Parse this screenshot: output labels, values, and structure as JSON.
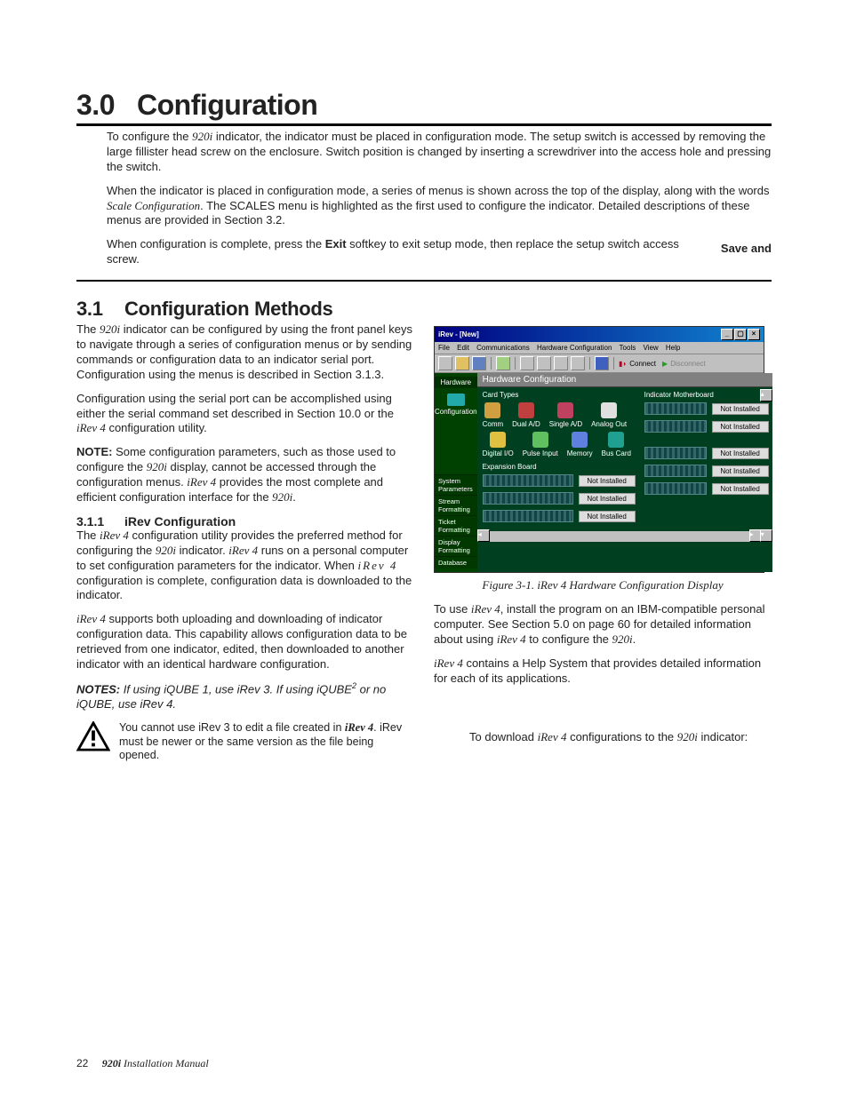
{
  "chapter": {
    "num": "3.0",
    "title": "Configuration"
  },
  "intro": {
    "p1_a": "To configure the ",
    "prod": "920i",
    "p1_b": " indicator, the indicator must be placed in configuration mode. The setup switch is accessed by removing the large fillister head screw on the enclosure. Switch position is changed by inserting a screwdriver into the access hole and pressing the switch.",
    "p2_a": "When the indicator is placed in configuration mode, a series of menus is shown across the top of the display, along with the words ",
    "p2_i": "Scale Configuration",
    "p2_b": ". The SCALES menu is highlighted as the first used to configure the indicator. Detailed descriptions of these menus are provided in Section 3.2.",
    "p3_a": "When configuration is complete, press the ",
    "p3_k": "Exit",
    "p3_b": " softkey to exit setup mode, then replace the setup switch access screw.",
    "aside_k": "Save and"
  },
  "section": {
    "num": "3.1",
    "title": "Configuration Methods"
  },
  "left": {
    "lead_a": "The ",
    "lead_b": " indicator can be configured by using the front panel keys to navigate through a series of configuration menus or by sending commands or configuration data to an indicator serial port. Configuration using the menus is described in Section 3.1.3.",
    "p2": "Configuration using the serial port can be accomplished using either the serial command set described in Section 10.0 or the ",
    "p2_i": "iRev 4",
    "p2_end": " configuration utility.",
    "note_lbl": "NOTE:",
    "note_a": " Some configuration parameters, such as those used to configure the ",
    "note_b": " display, cannot be accessed through the configuration menus. ",
    "note_c": " provides the most complete and efficient configuration interface for the ",
    "note_d": ".",
    "subsec": {
      "num": "3.1.1",
      "title": "iRev Configuration"
    },
    "s1_a": "The ",
    "s1_b": " configuration utility provides the preferred method for configuring the ",
    "s1_c": " indicator. ",
    "s1_d": " runs on a personal computer to set configuration parameters for the indicator. When ",
    "s1_e": " configuration is complete, configuration data is downloaded to the indicator.",
    "s2_a": "iRev 4",
    "s2_b": " supports both uploading and downloading of indicator configuration data. This capability allows configuration data to be retrieved from one indicator, edited, then downloaded to another indicator with an identical hardware configuration.",
    "notes_lbl": "NOTES:",
    "notes_txt": " If using iQUBE 1, use iRev 3. If using iQUBE",
    "notes_sup": "2",
    "notes_txt2": " or no iQUBE, use iRev 4.",
    "warn_a": "You cannot use iRev 3 to edit a file created in ",
    "warn_b": ". iRev must be newer or the same version as the file being opened."
  },
  "right": {
    "figcap_a": "Figure 3-1. ",
    "figcap_b": " Hardware Configuration Display",
    "p1_a": "To use ",
    "p1_b": ", install the program on an IBM-compatible personal computer. See Section 5.0 on page 60 for detailed information about using ",
    "p1_c": " to configure the ",
    "p1_d": ".",
    "p2_a": "iRev 4",
    "p2_b": " contains a Help System that provides detailed information for each of its applications.",
    "p3_a": "To download ",
    "p3_b": " configurations to the ",
    "p3_c": " indicator:"
  },
  "screenshot": {
    "title": "iRev - [New]",
    "menus": [
      "File",
      "Edit",
      "Communications",
      "Hardware Configuration",
      "Tools",
      "View",
      "Help"
    ],
    "connect": "Connect",
    "disconnect": "Disconnect",
    "side_header": "Hardware",
    "side_label": "Configuration",
    "side_items": [
      "System Parameters",
      "Stream Formatting",
      "Ticket Formatting",
      "Display Formatting",
      "Database"
    ],
    "hw_title": "Hardware Configuration",
    "card_types_lbl": "Card Types",
    "card_types": [
      "Comm",
      "Dual A/D",
      "Single A/D",
      "Analog Out",
      "Digital I/O",
      "Pulse Input",
      "Memory",
      "Bus Card"
    ],
    "exp_lbl": "Expansion Board",
    "mb_lbl": "Indicator Motherboard",
    "not_installed": "Not Installed"
  },
  "footer": {
    "page": "22",
    "book_i": "920i",
    "book": " Installation Manual"
  }
}
